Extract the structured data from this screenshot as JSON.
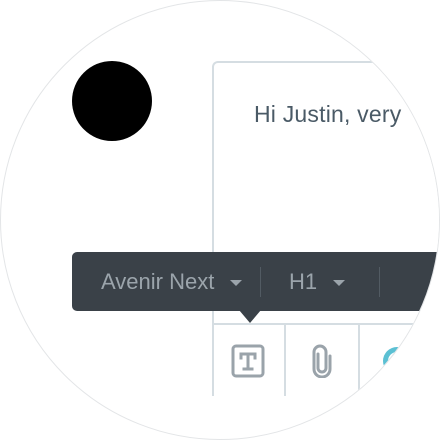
{
  "message": {
    "text": "Hi Justin, very"
  },
  "toolbar": {
    "font_family": "Avenir Next",
    "heading_level": "H1"
  },
  "tools": [
    {
      "icon": "text-format-icon"
    },
    {
      "icon": "paperclip-icon"
    },
    {
      "icon": "emoji-icon"
    }
  ],
  "colors": {
    "toolbar_bg": "#3a4148",
    "toolbar_text": "#9ba4ab",
    "editor_border": "#d5dde2",
    "message_text": "#4a5a66",
    "icon_gray": "#9aa3aa",
    "accent_teal": "#5bc0d3"
  }
}
